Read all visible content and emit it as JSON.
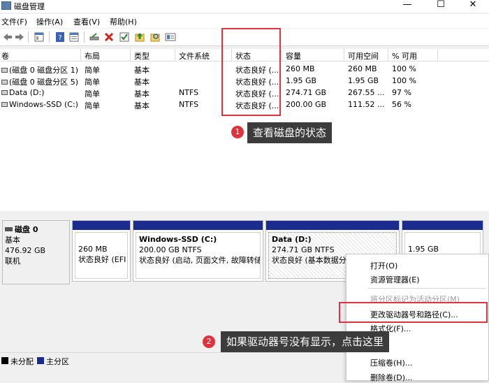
{
  "window": {
    "title": "磁盘管理",
    "controls": [
      "—",
      "☐",
      "✕"
    ]
  },
  "menu": [
    "文件(F)",
    "操作(A)",
    "查看(V)",
    "帮助(H)"
  ],
  "table": {
    "headers": [
      "卷",
      "布局",
      "类型",
      "文件系统",
      "状态",
      "容量",
      "可用空间",
      "% 可用"
    ],
    "rows": [
      [
        "(磁盘 0 磁盘分区 1)",
        "简单",
        "基本",
        "",
        "状态良好 (...",
        "260 MB",
        "260 MB",
        "100 %"
      ],
      [
        "(磁盘 0 磁盘分区 5)",
        "简单",
        "基本",
        "",
        "状态良好 (...",
        "1.95 GB",
        "1.95 GB",
        "100 %"
      ],
      [
        "Data (D:)",
        "简单",
        "基本",
        "NTFS",
        "状态良好 (...",
        "274.71 GB",
        "267.55 ...",
        "97 %"
      ],
      [
        "Windows-SSD (C:)",
        "简单",
        "基本",
        "NTFS",
        "状态良好 (...",
        "200.00 GB",
        "111.52 ...",
        "56 %"
      ]
    ]
  },
  "callouts": [
    {
      "number": "1",
      "text": "查看磁盘的状态"
    },
    {
      "number": "2",
      "text": "如果驱动器号没有显示，点击这里"
    }
  ],
  "disk": {
    "name": "磁盘 0",
    "type": "基本",
    "size": "476.92 GB",
    "status": "联机",
    "partitions": [
      {
        "title": "",
        "line1": "260 MB",
        "line2": "状态良好 (EFI 系"
      },
      {
        "title": "Windows-SSD  (C:)",
        "line1": "200.00 GB NTFS",
        "line2": "状态良好 (启动, 页面文件, 故障转储"
      },
      {
        "title": "Data  (D:)",
        "line1": "274.71 GB NTFS",
        "line2": "状态良好 (基本数据分"
      },
      {
        "title": "",
        "line1": "1.95 GB",
        "line2": ""
      }
    ]
  },
  "legend": [
    {
      "label": "未分配",
      "color": "#000000"
    },
    {
      "label": "主分区",
      "color": "#1a2d8f"
    }
  ],
  "context_menu": {
    "items": [
      {
        "label": "打开(O)",
        "enabled": true
      },
      {
        "label": "资源管理器(E)",
        "enabled": true
      },
      {
        "label": "将分区标记为活动分区(M)",
        "enabled": false
      },
      {
        "label": "更改驱动器号和路径(C)...",
        "enabled": true
      },
      {
        "label": "格式化(F)...",
        "enabled": true
      },
      {
        "label": "压缩卷(H)...",
        "enabled": true
      },
      {
        "label": "删除卷(D)...",
        "enabled": true
      }
    ]
  },
  "colors": {
    "highlight": "#e0323c",
    "primary_partition": "#1a2d8f",
    "callout_bg": "#3c3c3c"
  }
}
